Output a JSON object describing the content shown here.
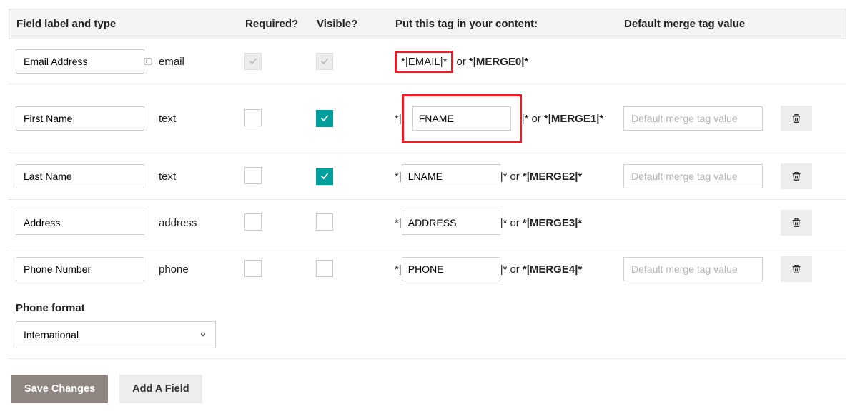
{
  "headers": {
    "field_label": "Field label and type",
    "required": "Required?",
    "visible": "Visible?",
    "tag": "Put this tag in your content:",
    "default": "Default merge tag value"
  },
  "rows": [
    {
      "label": "Email Address",
      "type": "email",
      "required_disabled": true,
      "required_checked": true,
      "visible_disabled": true,
      "visible_checked": true,
      "tag_display_only": true,
      "tag_highlight": "email-box",
      "tag_text": "*|EMAIL|*",
      "merge": "*|MERGE0|*",
      "has_default": false,
      "has_delete": false
    },
    {
      "label": "First Name",
      "type": "text",
      "required_disabled": false,
      "required_checked": false,
      "visible_disabled": false,
      "visible_checked": true,
      "tag_display_only": false,
      "tag_highlight": "fname-box",
      "tag_value": "FNAME",
      "merge": "*|MERGE1|*",
      "has_default": true,
      "has_delete": true
    },
    {
      "label": "Last Name",
      "type": "text",
      "required_disabled": false,
      "required_checked": false,
      "visible_disabled": false,
      "visible_checked": true,
      "tag_display_only": false,
      "tag_highlight": null,
      "tag_value": "LNAME",
      "merge": "*|MERGE2|*",
      "has_default": true,
      "has_delete": true
    },
    {
      "label": "Address",
      "type": "address",
      "required_disabled": false,
      "required_checked": false,
      "visible_disabled": false,
      "visible_checked": false,
      "tag_display_only": false,
      "tag_highlight": null,
      "tag_value": "ADDRESS",
      "merge": "*|MERGE3|*",
      "has_default": false,
      "has_delete": true
    },
    {
      "label": "Phone Number",
      "type": "phone",
      "required_disabled": false,
      "required_checked": false,
      "visible_disabled": false,
      "visible_checked": false,
      "tag_display_only": false,
      "tag_highlight": null,
      "tag_value": "PHONE",
      "merge": "*|MERGE4|*",
      "has_default": true,
      "has_delete": true
    }
  ],
  "tag_prefix": "*|",
  "tag_suffix": "|*",
  "tag_or": " or ",
  "default_placeholder": "Default merge tag value",
  "phone_format": {
    "label": "Phone format",
    "value": "International"
  },
  "buttons": {
    "save": "Save Changes",
    "add": "Add A Field"
  }
}
